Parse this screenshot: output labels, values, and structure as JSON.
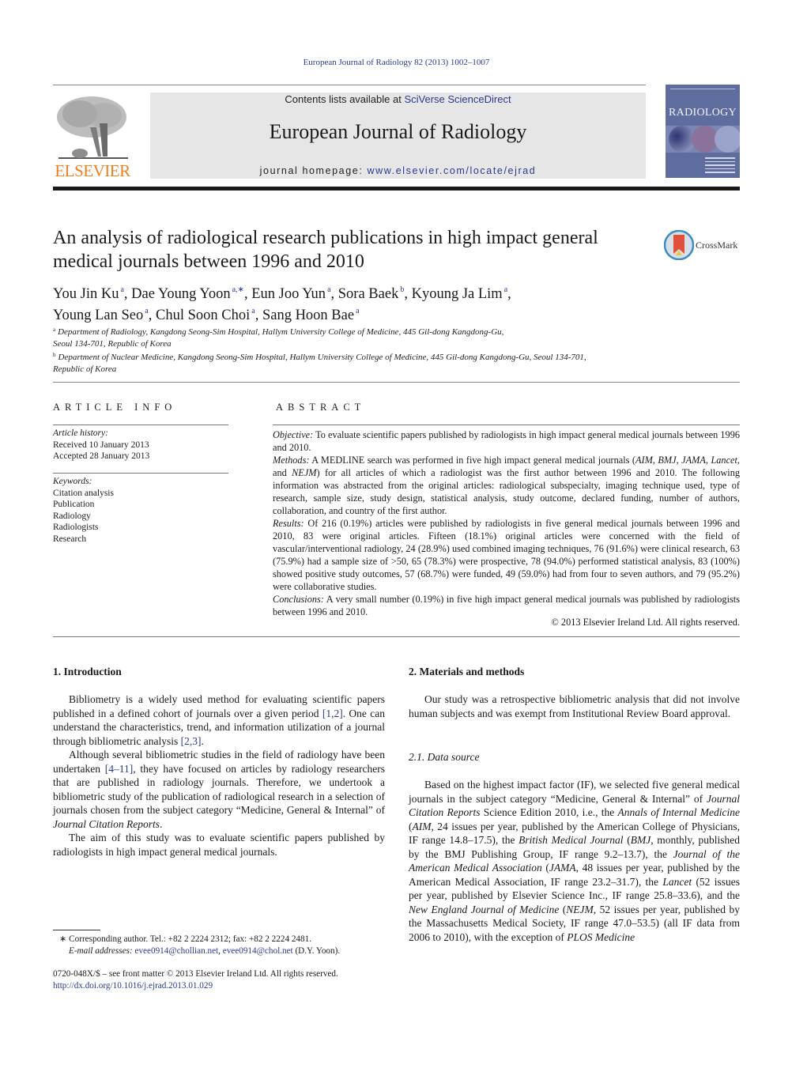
{
  "header": {
    "citation": "European Journal of Radiology 82 (2013) 1002–1007",
    "contents_prefix": "Contents lists available at ",
    "contents_link": "SciVerse ScienceDirect",
    "journal_title": "European Journal of Radiology",
    "homepage_prefix": "journal homepage: ",
    "homepage_link": "www.elsevier.com/locate/ejrad",
    "publisher_logo_text": "ELSEVIER",
    "cover_title": "RADIOLOGY",
    "colors": {
      "link": "#2a3a8f",
      "elsevier_orange": "#f07f1c",
      "banner_bg": "#e6e6e6",
      "cover_bg": "#5f6c9e"
    }
  },
  "article": {
    "title": "An analysis of radiological research publications in high impact general medical journals between 1996 and 2010",
    "crossmark_label": "CrossMark",
    "authors": [
      {
        "name": "You Jin Ku",
        "sup": "a"
      },
      {
        "name": "Dae Young Yoon",
        "sup": "a,∗"
      },
      {
        "name": "Eun Joo Yun",
        "sup": "a"
      },
      {
        "name": "Sora Baek",
        "sup": "b"
      },
      {
        "name": "Kyoung Ja Lim",
        "sup": "a"
      },
      {
        "name": "Young Lan Seo",
        "sup": "a"
      },
      {
        "name": "Chul Soon Choi",
        "sup": "a"
      },
      {
        "name": "Sang Hoon Bae",
        "sup": "a"
      }
    ],
    "affiliations": [
      {
        "sup": "a",
        "text": "Department of Radiology, Kangdong Seong-Sim Hospital, Hallym University College of Medicine, 445 Gil-dong Kangdong-Gu,",
        "text2": "Seoul 134-701, Republic of Korea"
      },
      {
        "sup": "b",
        "text": "Department of Nuclear Medicine, Kangdong Seong-Sim Hospital, Hallym University College of Medicine, 445 Gil-dong Kangdong-Gu, Seoul 134-701,",
        "text2": "Republic of Korea"
      }
    ]
  },
  "article_info": {
    "heading": "ARTICLE INFO",
    "history_label": "Article history:",
    "received": "Received 10 January 2013",
    "accepted": "Accepted 28 January 2013",
    "keywords_label": "Keywords:",
    "keywords": [
      "Citation analysis",
      "Publication",
      "Radiology",
      "Radiologists",
      "Research"
    ]
  },
  "abstract": {
    "heading": "ABSTRACT",
    "objective_label": "Objective:",
    "objective": " To evaluate scientific papers published by radiologists in high impact general medical journals between 1996 and 2010.",
    "methods_label": "Methods:",
    "methods_a": " A MEDLINE search was performed in five high impact general medical journals (",
    "methods_j1": "AIM",
    "methods_j2": "BMJ",
    "methods_j3": "JAMA",
    "methods_j4": "Lancet",
    "methods_j5": "NEJM",
    "methods_b": ") for all articles of which a radiologist was the first author between 1996 and 2010. The following information was abstracted from the original articles: radiological subspecialty, imaging technique used, type of research, sample size, study design, statistical analysis, study outcome, declared funding, number of authors, collaboration, and country of the first author.",
    "results_label": "Results:",
    "results": " Of 216 (0.19%) articles were published by radiologists in five general medical journals between 1996 and 2010, 83 were original articles. Fifteen (18.1%) original articles were concerned with the field of vascular/interventional radiology, 24 (28.9%) used combined imaging techniques, 76 (91.6%) were clinical research, 63 (75.9%) had a sample size of >50, 65 (78.3%) were prospective, 78 (94.0%) performed statistical analysis, 83 (100%) showed positive study outcomes, 57 (68.7%) were funded, 49 (59.0%) had from four to seven authors, and 79 (95.2%) were collaborative studies.",
    "conclusions_label": "Conclusions:",
    "conclusions": " A very small number (0.19%) in five high impact general medical journals was published by radiologists between 1996 and 2010.",
    "copyright": "© 2013 Elsevier Ireland Ltd. All rights reserved."
  },
  "intro": {
    "heading": "1.  Introduction",
    "p1_a": "Bibliometry is a widely used method for evaluating scientific papers published in a defined cohort of journals over a given period ",
    "p1_ref1": "[1,2]",
    "p1_b": ". One can understand the characteristics, trend, and information utilization of a journal through bibliometric analysis ",
    "p1_ref2": "[2,3]",
    "p1_c": ".",
    "p2_a": "Although several bibliometric studies in the field of radiology have been undertaken ",
    "p2_ref": "[4–11]",
    "p2_b": ", they have focused on articles by radiology researchers that are published in radiology journals. Therefore, we undertook a bibliometric study of the publication of radiological research in a selection of journals chosen from the subject category “Medicine, General & Internal” of ",
    "p2_ital": "Journal Citation Reports",
    "p2_c": ".",
    "p3": "The aim of this study was to evaluate scientific papers published by radiologists in high impact general medical journals."
  },
  "methods": {
    "heading": "2.  Materials and methods",
    "p1": "Our study was a retrospective bibliometric analysis that did not involve human subjects and was exempt from Institutional Review Board approval.",
    "sub_heading": "2.1.  Data source",
    "ds_1": "Based on the highest impact factor (IF), we selected five general medical journals in the subject category “Medicine, General & Internal” of ",
    "ds_jcr": "Journal Citation Reports",
    "ds_2": " Science Edition 2010, i.e., the ",
    "ds_aim_full": "Annals of Internal Medicine",
    "ds_3": " (",
    "ds_aim": "AIM",
    "ds_4": ", 24 issues per year, published by the American College of Physicians, IF range 14.8–17.5), the ",
    "ds_bmj_full": "British Medical Journal",
    "ds_5": " (",
    "ds_bmj": "BMJ",
    "ds_6": ", monthly, published by the BMJ Publishing Group, IF range 9.2–13.7), the ",
    "ds_jama_full": "Journal of the American Medical Association",
    "ds_7": " (",
    "ds_jama": "JAMA",
    "ds_8": ", 48 issues per year, published by the American Medical Association, IF range 23.2–31.7), the ",
    "ds_lancet": "Lancet",
    "ds_9": " (52 issues per year, published by Elsevier Science Inc., IF range 25.8–33.6), and the ",
    "ds_nejm_full": "New England Journal of Medicine",
    "ds_10": " (",
    "ds_nejm": "NEJM",
    "ds_11": ", 52 issues per year, published by the Massachusetts Medical Society, IF range 47.0–53.5) (all IF data from 2006 to 2010), with the exception of ",
    "ds_plos": "PLOS Medicine"
  },
  "footnote": {
    "star_line": "∗  Corresponding author. Tel.: +82 2 2224 2312; fax: +82 2 2224 2481.",
    "email_label": "E-mail addresses:",
    "email1": "evee0914@chollian.net",
    "email_sep": ", ",
    "email2": "evee0914@chol.net",
    "email_tail": " (D.Y. Yoon).",
    "front_matter": "0720-048X/$ – see front matter © 2013 Elsevier Ireland Ltd. All rights reserved.",
    "doi": "http://dx.doi.org/10.1016/j.ejrad.2013.01.029"
  }
}
